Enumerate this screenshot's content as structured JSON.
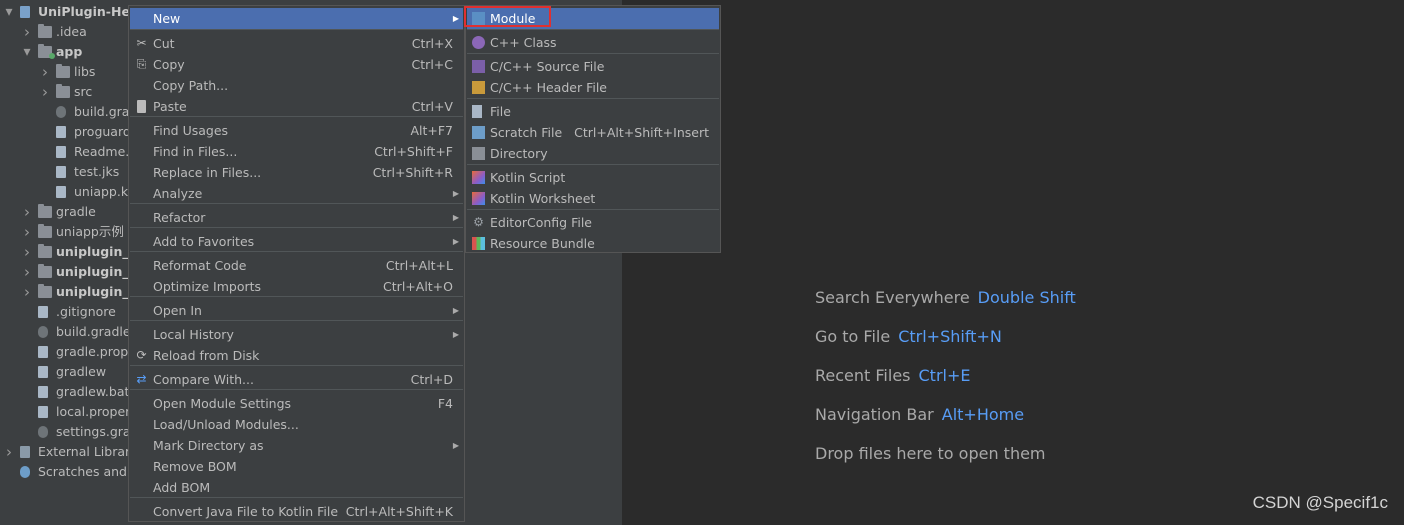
{
  "project_tree": {
    "items": [
      {
        "label": "UniPlugin-Hel",
        "arrow": "▼",
        "bold": true,
        "icon": "module-icon"
      },
      {
        "label": ".idea",
        "arrow": "›",
        "icon": "folder-icon"
      },
      {
        "label": "app",
        "arrow": "▼",
        "bold": true,
        "icon": "folder-icon"
      },
      {
        "label": "libs",
        "arrow": "›",
        "icon": "folder-icon"
      },
      {
        "label": "src",
        "arrow": "›",
        "icon": "folder-icon"
      },
      {
        "label": "build.gra",
        "arrow": "",
        "icon": "gradle-icon"
      },
      {
        "label": "proguard",
        "arrow": "",
        "icon": "file-icon"
      },
      {
        "label": "Readme.",
        "arrow": "",
        "icon": "file-icon"
      },
      {
        "label": "test.jks",
        "arrow": "",
        "icon": "file-icon"
      },
      {
        "label": "uniapp.k",
        "arrow": "",
        "icon": "file-icon"
      },
      {
        "label": "gradle",
        "arrow": "›",
        "icon": "folder-icon"
      },
      {
        "label": "uniapp示例",
        "arrow": "›",
        "icon": "folder-icon"
      },
      {
        "label": "uniplugin_c",
        "arrow": "›",
        "bold": true,
        "icon": "folder-icon"
      },
      {
        "label": "uniplugin_r",
        "arrow": "›",
        "bold": true,
        "icon": "folder-icon"
      },
      {
        "label": "uniplugin_r",
        "arrow": "›",
        "bold": true,
        "icon": "folder-icon"
      },
      {
        "label": ".gitignore",
        "arrow": "",
        "icon": "file-icon"
      },
      {
        "label": "build.gradle",
        "arrow": "",
        "icon": "gradle-icon"
      },
      {
        "label": "gradle.prop",
        "arrow": "",
        "icon": "file-icon"
      },
      {
        "label": "gradlew",
        "arrow": "",
        "icon": "file-icon"
      },
      {
        "label": "gradlew.bat",
        "arrow": "",
        "icon": "file-icon"
      },
      {
        "label": "local.proper",
        "arrow": "",
        "icon": "file-icon"
      },
      {
        "label": "settings.gra",
        "arrow": "",
        "icon": "gradle-icon"
      },
      {
        "label": "External Librari",
        "arrow": "›",
        "icon": "library-icon"
      },
      {
        "label": "Scratches and C",
        "arrow": "",
        "icon": "scratches-icon"
      }
    ]
  },
  "context_menu": {
    "items": [
      {
        "label": "New",
        "shortcut": "",
        "submenu": true,
        "highlighted": true
      },
      {
        "label": "Cut",
        "shortcut": "Ctrl+X",
        "icon": "✂"
      },
      {
        "label": "Copy",
        "shortcut": "Ctrl+C",
        "icon": "⎘"
      },
      {
        "label": "Copy Path...",
        "shortcut": ""
      },
      {
        "label": "Paste",
        "shortcut": "Ctrl+V",
        "icon": "📋"
      },
      {
        "label": "Find Usages",
        "shortcut": "Alt+F7"
      },
      {
        "label": "Find in Files...",
        "shortcut": "Ctrl+Shift+F"
      },
      {
        "label": "Replace in Files...",
        "shortcut": "Ctrl+Shift+R"
      },
      {
        "label": "Analyze",
        "shortcut": "",
        "submenu": true
      },
      {
        "label": "Refactor",
        "shortcut": "",
        "submenu": true
      },
      {
        "label": "Add to Favorites",
        "shortcut": "",
        "submenu": true
      },
      {
        "label": "Reformat Code",
        "shortcut": "Ctrl+Alt+L"
      },
      {
        "label": "Optimize Imports",
        "shortcut": "Ctrl+Alt+O"
      },
      {
        "label": "Open In",
        "shortcut": "",
        "submenu": true
      },
      {
        "label": "Local History",
        "shortcut": "",
        "submenu": true
      },
      {
        "label": "Reload from Disk",
        "shortcut": "",
        "icon": "⟳"
      },
      {
        "label": "Compare With...",
        "shortcut": "Ctrl+D",
        "icon": "⇄"
      },
      {
        "label": "Open Module Settings",
        "shortcut": "F4"
      },
      {
        "label": "Load/Unload Modules...",
        "shortcut": ""
      },
      {
        "label": "Mark Directory as",
        "shortcut": "",
        "submenu": true
      },
      {
        "label": "Remove BOM",
        "shortcut": ""
      },
      {
        "label": "Add BOM",
        "shortcut": ""
      },
      {
        "label": "Convert Java File to Kotlin File",
        "shortcut": "Ctrl+Alt+Shift+K"
      }
    ]
  },
  "new_submenu": {
    "items": [
      {
        "label": "Module",
        "shortcut": "",
        "highlighted": true,
        "icon": "module-icon"
      },
      {
        "label": "C++ Class",
        "shortcut": "",
        "icon": "cpp-class-icon"
      },
      {
        "label": "C/C++ Source File",
        "shortcut": "",
        "icon": "cpp-source-icon"
      },
      {
        "label": "C/C++ Header File",
        "shortcut": "",
        "icon": "cpp-header-icon"
      },
      {
        "label": "File",
        "shortcut": "",
        "icon": "file-icon"
      },
      {
        "label": "Scratch File",
        "shortcut": "Ctrl+Alt+Shift+Insert",
        "icon": "scratch-file-icon"
      },
      {
        "label": "Directory",
        "shortcut": "",
        "icon": "folder-icon"
      },
      {
        "label": "Kotlin Script",
        "shortcut": "",
        "icon": "kotlin-icon"
      },
      {
        "label": "Kotlin Worksheet",
        "shortcut": "",
        "icon": "kotlin-icon"
      },
      {
        "label": "EditorConfig File",
        "shortcut": "",
        "icon": "gear-icon"
      },
      {
        "label": "Resource Bundle",
        "shortcut": "",
        "icon": "resource-bundle-icon"
      }
    ]
  },
  "welcome": {
    "rows": [
      {
        "label": "Search Everywhere",
        "shortcut": "Double Shift"
      },
      {
        "label": "Go to File",
        "shortcut": "Ctrl+Shift+N"
      },
      {
        "label": "Recent Files",
        "shortcut": "Ctrl+E"
      },
      {
        "label": "Navigation Bar",
        "shortcut": "Alt+Home"
      },
      {
        "label": "Drop files here to open them",
        "shortcut": ""
      }
    ]
  },
  "watermark": "CSDN @Specif1c",
  "colors": {
    "accent": "#4b6eaf",
    "shortcut_blue": "#589df6",
    "highlight_box": "#e03030",
    "panel": "#3c3f41",
    "editor": "#2b2b2b"
  }
}
